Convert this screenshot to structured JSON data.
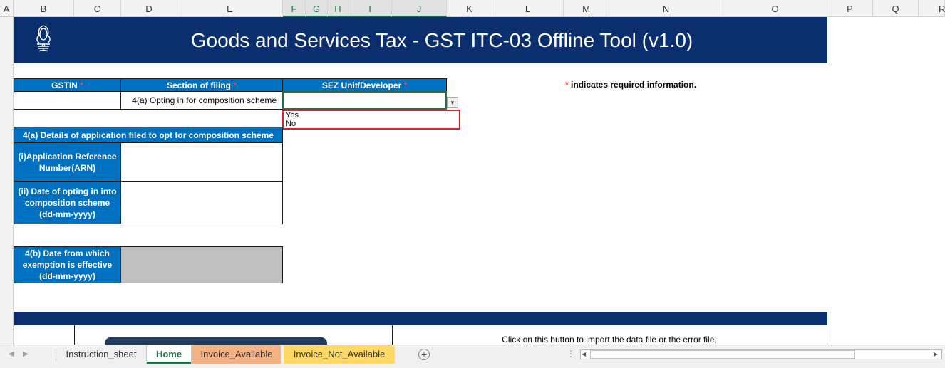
{
  "columns": [
    "A",
    "B",
    "C",
    "D",
    "E",
    "F",
    "G",
    "H",
    "I",
    "J",
    "K",
    "L",
    "M",
    "N",
    "O",
    "P",
    "Q",
    "R"
  ],
  "selected_columns": [
    "F",
    "G",
    "H",
    "I",
    "J"
  ],
  "banner": {
    "title": "Goods and Services Tax - GST ITC-03 Offline Tool (v1.0)"
  },
  "form": {
    "gstin_label": "GSTIN",
    "section_label": "Section of filing",
    "sez_label": "SEZ Unit/Developer",
    "required_mark": "*",
    "gstin_value": "",
    "section_value": "4(a) Opting in for composition scheme",
    "sez_value": "",
    "sez_options": [
      "Yes",
      "No"
    ]
  },
  "required_note": {
    "mark": "*",
    "text": " indicates required information."
  },
  "section_4a": {
    "header": "4(a) Details of application filed to opt for composition scheme",
    "arn_label": "(i)Application Reference Number(ARN)",
    "arn_value": "",
    "date_label": "(ii) Date of opting in into composition scheme (dd-mm-yyyy)",
    "date_value": ""
  },
  "section_4b": {
    "label": "4(b) Date from which exemption is effective (dd-mm-yyyy)"
  },
  "import": {
    "description": "Click on this button to import the data file or the error file,"
  },
  "sheet_tabs": [
    {
      "label": "Instruction_sheet",
      "color": "#f0f0f0",
      "active": false
    },
    {
      "label": "Home",
      "color": "#ffffff",
      "active": true
    },
    {
      "label": "Invoice_Available",
      "color": "#f4b183",
      "active": false
    },
    {
      "label": "Invoice_Not_Available",
      "color": "#ffd966",
      "active": false
    }
  ],
  "colors": {
    "banner": "#0b2f6e",
    "header_blue": "#0070c0",
    "required_red": "#ff0000",
    "dropdown_highlight": "#e0202a"
  }
}
